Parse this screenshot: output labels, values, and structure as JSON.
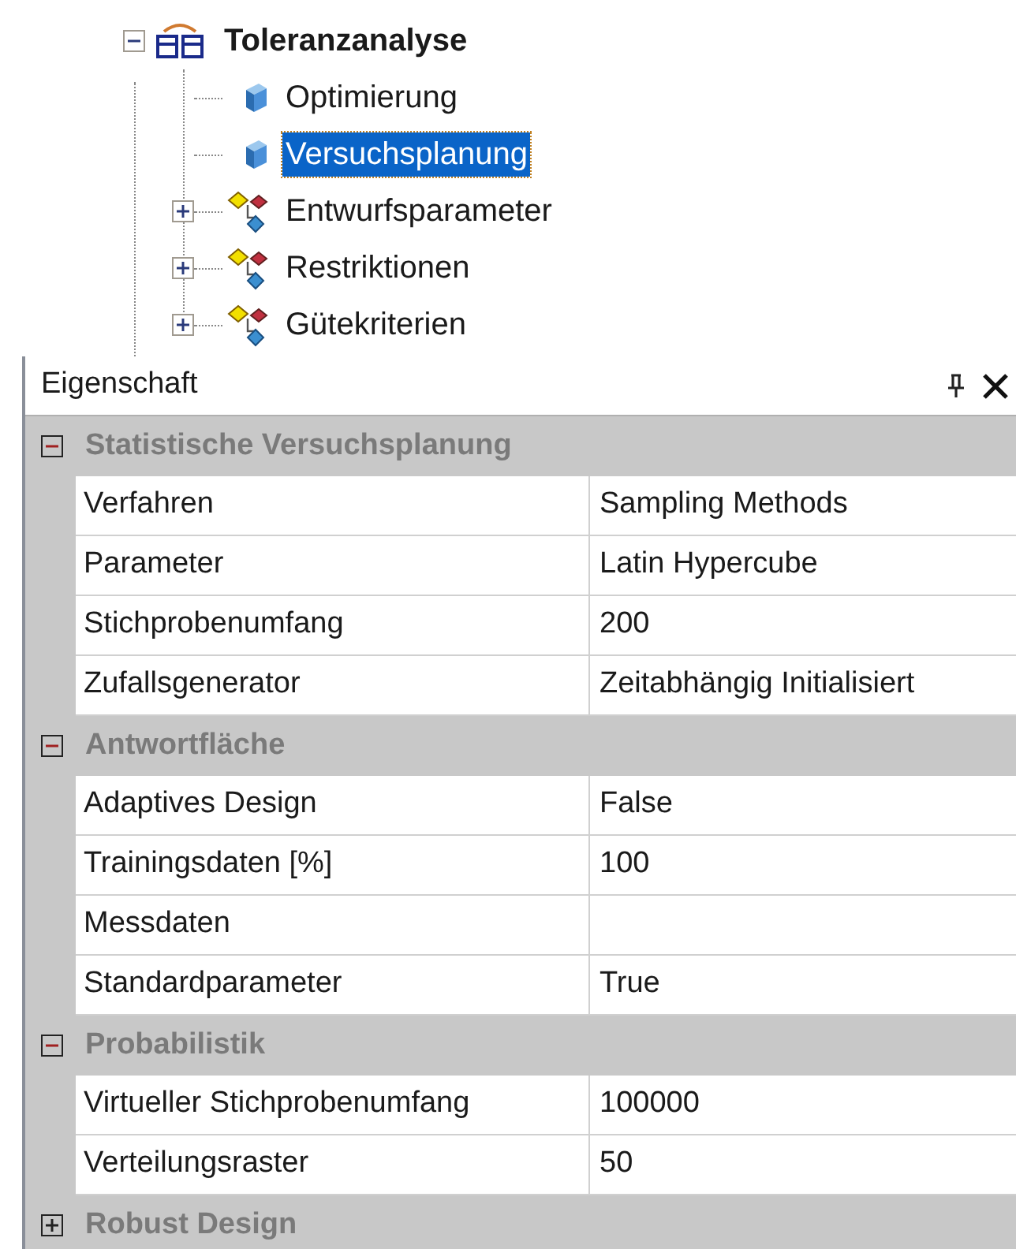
{
  "tree": {
    "label": "Toleranzanalyse",
    "kind": "analysis",
    "expanded": true,
    "children": [
      {
        "label": "Optimierung",
        "kind": "leaf",
        "selected": false
      },
      {
        "label": "Versuchsplanung",
        "kind": "leaf",
        "selected": true
      },
      {
        "label": "Entwurfsparameter",
        "kind": "group",
        "selected": false,
        "expanded": false
      },
      {
        "label": "Restriktionen",
        "kind": "group",
        "selected": false,
        "expanded": false
      },
      {
        "label": "Gütekriterien",
        "kind": "group",
        "selected": false,
        "expanded": false
      }
    ]
  },
  "panel": {
    "title": "Eigenschaft",
    "categories": [
      {
        "name": "Statistische Versuchsplanung",
        "expanded": true,
        "properties": [
          {
            "name": "Verfahren",
            "value": "Sampling Methods"
          },
          {
            "name": "Parameter",
            "value": "Latin Hypercube"
          },
          {
            "name": "Stichprobenumfang",
            "value": "200"
          },
          {
            "name": "Zufallsgenerator",
            "value": "Zeitabhängig Initialisiert"
          }
        ]
      },
      {
        "name": "Antwortfläche",
        "expanded": true,
        "properties": [
          {
            "name": "Adaptives Design",
            "value": "False"
          },
          {
            "name": "Trainingsdaten [%]",
            "value": "100"
          },
          {
            "name": "Messdaten"
          },
          {
            "name": "Standardparameter",
            "value": "True"
          }
        ]
      },
      {
        "name": "Probabilistik",
        "expanded": true,
        "properties": [
          {
            "name": "Virtueller Stichprobenumfang",
            "value": "100000"
          },
          {
            "name": "Verteilungsraster",
            "value": "50"
          }
        ]
      },
      {
        "name": "Robust Design",
        "expanded": false
      }
    ]
  }
}
